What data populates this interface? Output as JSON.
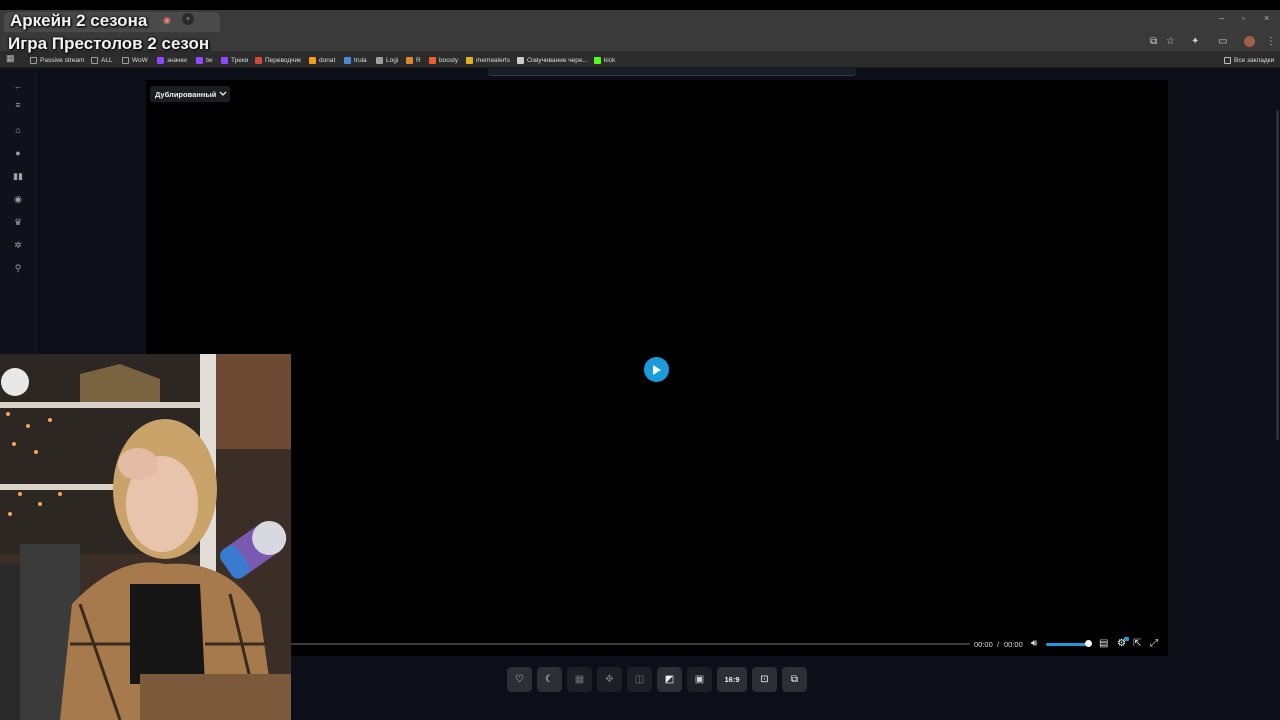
{
  "overlay": {
    "title_line1": "Аркейн 2 сезона",
    "title_line2": "Игра Престолов 2 сезон"
  },
  "browser": {
    "icons": [
      "cast-icon",
      "star-icon",
      "extensions-icon",
      "screen-icon",
      "profile-avatar",
      "menu-icon"
    ],
    "bookmarks": [
      {
        "label": "Passive stream",
        "icon": "folder",
        "color": "#9aa0a6"
      },
      {
        "label": "ALL",
        "icon": "folder",
        "color": "#9aa0a6"
      },
      {
        "label": "WoW",
        "icon": "folder",
        "color": "#9aa0a6"
      },
      {
        "label": "значки",
        "icon": "twitch",
        "color": "#9146ff"
      },
      {
        "label": "tw",
        "icon": "twitch",
        "color": "#9146ff"
      },
      {
        "label": "Треки",
        "icon": "twitch",
        "color": "#9146ff"
      },
      {
        "label": "Переводчик",
        "icon": "translate",
        "color": "#d04a3a"
      },
      {
        "label": "donat",
        "icon": "donationalerts",
        "color": "#f59c1a"
      },
      {
        "label": "trula",
        "icon": "square",
        "color": "#4a8ad6"
      },
      {
        "label": "Logi",
        "icon": "ring",
        "color": "#9aa0a6"
      },
      {
        "label": "R",
        "icon": "rocket",
        "color": "#e08a2a"
      },
      {
        "label": "boosty",
        "icon": "boosty",
        "color": "#f15f2c"
      },
      {
        "label": "memealerts",
        "icon": "meme",
        "color": "#e0b020"
      },
      {
        "label": "Озвучивание чере...",
        "icon": "doc",
        "color": "#cccccc"
      },
      {
        "label": "kick",
        "icon": "kick",
        "color": "#53fc18"
      }
    ],
    "all_bookmarks": "Все закладки"
  },
  "sidebar": {
    "items": [
      "back-icon",
      "menu-icon",
      "home-icon",
      "trending-icon",
      "catalog-icon",
      "random-icon",
      "trophy-icon",
      "settings-icon",
      "search-icon"
    ]
  },
  "player": {
    "dub_select": "Дублированный",
    "time_current": "00:00",
    "time_separator": "/",
    "time_total": "00:00",
    "volume_level": 1.0,
    "progress": 0,
    "accent_color": "#1a9bdc"
  },
  "toolbar": {
    "aspect_ratio": "16:9",
    "buttons": [
      "favorite-icon",
      "night-mode-icon",
      "ambient-icon",
      "light-icon",
      "split-icon",
      "crop-icon",
      "pip-icon",
      "aspect-ratio",
      "screenshot-icon",
      "external-icon"
    ]
  }
}
